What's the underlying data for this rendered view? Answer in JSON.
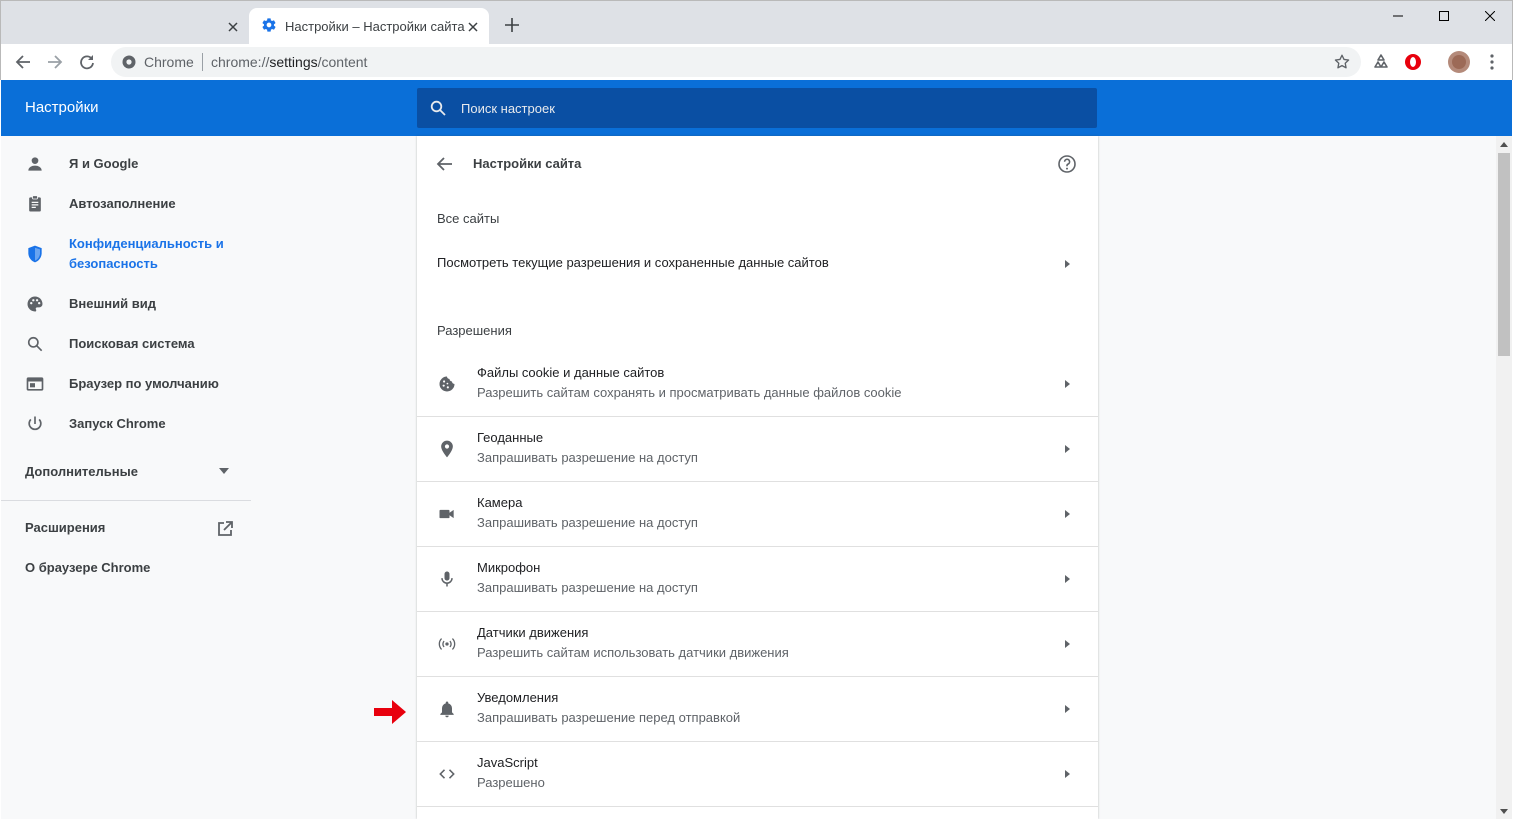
{
  "tabs": {
    "inactive": {
      "title": "",
      "close": "✕"
    },
    "active": {
      "title": "Настройки – Настройки сайта",
      "close": "✕"
    },
    "new_tab": "+"
  },
  "toolbar": {
    "omnibox_chip": "Chrome",
    "url_prefix": "chrome://",
    "url_path": "settings",
    "url_rest": "/content"
  },
  "header": {
    "title": "Настройки",
    "search_placeholder": "Поиск настроек"
  },
  "sidebar": {
    "items": [
      {
        "label": "Я и Google",
        "icon": "person-icon"
      },
      {
        "label": "Автозаполнение",
        "icon": "clipboard-icon"
      },
      {
        "label": "Конфиденциальность и безопасность",
        "icon": "shield-icon",
        "active": true
      },
      {
        "label": "Внешний вид",
        "icon": "palette-icon"
      },
      {
        "label": "Поисковая система",
        "icon": "search-icon"
      },
      {
        "label": "Браузер по умолчанию",
        "icon": "browser-icon"
      },
      {
        "label": "Запуск Chrome",
        "icon": "power-icon"
      }
    ],
    "advanced": "Дополнительные",
    "extensions": "Расширения",
    "about": "О браузере Chrome"
  },
  "card": {
    "title": "Настройки сайта",
    "all_sites_section": "Все сайты",
    "all_sites_row": "Посмотреть текущие разрешения и сохраненные данные сайтов",
    "permissions_section": "Разрешения",
    "permissions": [
      {
        "title": "Файлы cookie и данные сайтов",
        "subtitle": "Разрешить сайтам сохранять и просматривать данные файлов cookie",
        "icon": "cookie-icon"
      },
      {
        "title": "Геоданные",
        "subtitle": "Запрашивать разрешение на доступ",
        "icon": "location-pin-icon"
      },
      {
        "title": "Камера",
        "subtitle": "Запрашивать разрешение на доступ",
        "icon": "camera-icon"
      },
      {
        "title": "Микрофон",
        "subtitle": "Запрашивать разрешение на доступ",
        "icon": "microphone-icon"
      },
      {
        "title": "Датчики движения",
        "subtitle": "Разрешить сайтам использовать датчики движения",
        "icon": "sensors-icon"
      },
      {
        "title": "Уведомления",
        "subtitle": "Запрашивать разрешение перед отправкой",
        "icon": "bell-icon"
      },
      {
        "title": "JavaScript",
        "subtitle": "Разрешено",
        "icon": "code-icon"
      }
    ]
  },
  "colors": {
    "brand_blue": "#1a73e8",
    "header_blue": "#0a6fd8",
    "annotation_red": "#e8000d"
  }
}
